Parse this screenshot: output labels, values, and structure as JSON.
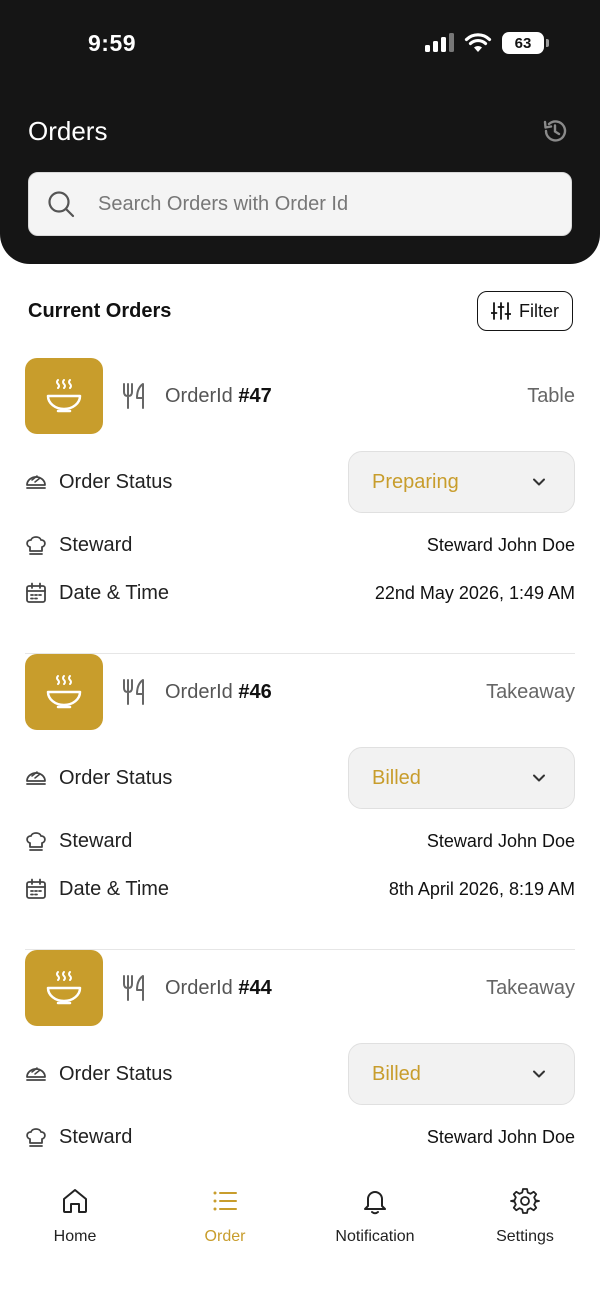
{
  "status_bar": {
    "time": "9:59",
    "battery": "63"
  },
  "header": {
    "title": "Orders",
    "search_placeholder": "Search Orders with Order Id"
  },
  "section": {
    "title": "Current Orders",
    "filter_label": "Filter"
  },
  "labels": {
    "order_id_prefix": "OrderId",
    "order_status": "Order Status",
    "steward": "Steward",
    "date_time": "Date & Time"
  },
  "orders": [
    {
      "number": "#47",
      "type": "Table",
      "status": "Preparing",
      "steward": "Steward John Doe",
      "datetime": "22nd May 2026, 1:49 AM"
    },
    {
      "number": "#46",
      "type": "Takeaway",
      "status": "Billed",
      "steward": "Steward John Doe",
      "datetime": "8th April 2026, 8:19 AM"
    },
    {
      "number": "#44",
      "type": "Takeaway",
      "status": "Billed",
      "steward": "Steward John Doe",
      "datetime": ""
    }
  ],
  "tabs": [
    {
      "label": "Home",
      "icon": "home-icon",
      "active": false
    },
    {
      "label": "Order",
      "icon": "list-icon",
      "active": true
    },
    {
      "label": "Notification",
      "icon": "bell-icon",
      "active": false
    },
    {
      "label": "Settings",
      "icon": "gear-icon",
      "active": false
    }
  ],
  "colors": {
    "header_bg": "#151515",
    "accent": "#c89d2c",
    "card_divider": "#e6e6e6"
  }
}
